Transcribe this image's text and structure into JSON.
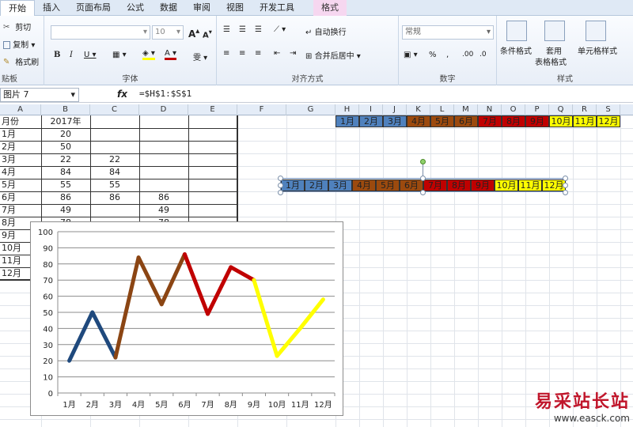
{
  "ribbon": {
    "tabs": [
      "开始",
      "插入",
      "页面布局",
      "公式",
      "数据",
      "审阅",
      "视图",
      "开发工具",
      "格式"
    ],
    "clipboard": {
      "cut": "剪切",
      "copy": "复制",
      "painter": "格式刷",
      "label": "贴板"
    },
    "font": {
      "size": "10",
      "label": "字体"
    },
    "alignment": {
      "wrap": "自动换行",
      "merge": "合并后居中",
      "label": "对齐方式"
    },
    "number": {
      "format": "常规",
      "label": "数字"
    },
    "styles": {
      "conditional": "条件格式",
      "table_top": "套用",
      "table_bottom": "表格格式",
      "cell": "单元格样式",
      "label": "样式"
    }
  },
  "formula_bar": {
    "name_box": "图片 7",
    "fx": "fx",
    "formula": "=$H$1:$S$1"
  },
  "columns": [
    "A",
    "B",
    "C",
    "D",
    "E",
    "F",
    "G",
    "H",
    "I",
    "J",
    "K",
    "L",
    "M",
    "N",
    "O",
    "P",
    "Q",
    "R",
    "S"
  ],
  "table": {
    "header_a": "月份",
    "header_b": "2017年",
    "rows": [
      {
        "month": "1月",
        "b": "20",
        "c": "",
        "d": ""
      },
      {
        "month": "2月",
        "b": "50",
        "c": "",
        "d": ""
      },
      {
        "month": "3月",
        "b": "22",
        "c": "22",
        "d": ""
      },
      {
        "month": "4月",
        "b": "84",
        "c": "84",
        "d": ""
      },
      {
        "month": "5月",
        "b": "55",
        "c": "55",
        "d": ""
      },
      {
        "month": "6月",
        "b": "86",
        "c": "86",
        "d": "86"
      },
      {
        "month": "7月",
        "b": "49",
        "c": "",
        "d": "49"
      },
      {
        "month": "8月",
        "b": "78",
        "c": "",
        "d": "78"
      },
      {
        "month": "9月",
        "b": "",
        "c": "",
        "d": ""
      },
      {
        "month": "10月",
        "b": "",
        "c": "",
        "d": ""
      },
      {
        "month": "11月",
        "b": "",
        "c": "",
        "d": ""
      },
      {
        "month": "12月",
        "b": "",
        "c": "",
        "d": ""
      }
    ]
  },
  "month_bar": {
    "labels": [
      "1月",
      "2月",
      "3月",
      "4月",
      "5月",
      "6月",
      "7月",
      "8月",
      "9月",
      "10月",
      "11月",
      "12月"
    ],
    "colors": [
      "#4f81bd",
      "#4f81bd",
      "#4f81bd",
      "#9c4a0e",
      "#9c4a0e",
      "#9c4a0e",
      "#c00000",
      "#c00000",
      "#c00000",
      "#ffff00",
      "#ffff00",
      "#ffff00"
    ]
  },
  "chart_data": {
    "type": "line",
    "categories": [
      "1月",
      "2月",
      "3月",
      "4月",
      "5月",
      "6月",
      "7月",
      "8月",
      "9月",
      "10月",
      "11月",
      "12月"
    ],
    "values": [
      20,
      50,
      22,
      84,
      55,
      86,
      49,
      78,
      70,
      23,
      40,
      58
    ],
    "segment_colors": [
      "#1f497d",
      "#1f497d",
      "#8b4513",
      "#8b4513",
      "#8b4513",
      "#c00000",
      "#c00000",
      "#c00000",
      "#ffff00",
      "#ffff00",
      "#ffff00"
    ],
    "ylim": [
      0,
      100
    ],
    "yticks": [
      0,
      10,
      20,
      30,
      40,
      50,
      60,
      70,
      80,
      90,
      100
    ],
    "grid": true,
    "title": "",
    "xlabel": "",
    "ylabel": ""
  },
  "watermark": {
    "line1": "易采站长站",
    "line2": "www.easck.com"
  }
}
